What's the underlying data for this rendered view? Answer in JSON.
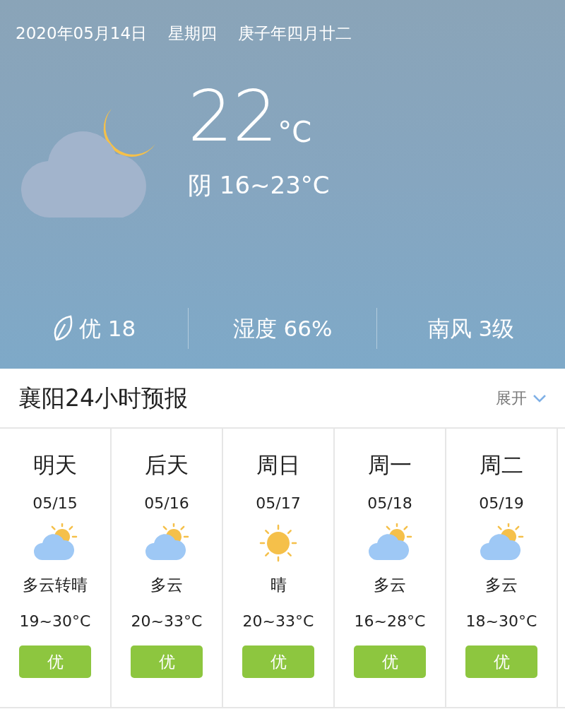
{
  "header": {
    "date": "2020年05月14日",
    "weekday": "星期四",
    "lunar": "庚子年四月廿二"
  },
  "current": {
    "temp": "22",
    "unit": "°C",
    "summary": "阴 16~23°C"
  },
  "stats": [
    {
      "kind": "aqi",
      "text": "优 18"
    },
    {
      "kind": "plain",
      "text": "湿度 66%"
    },
    {
      "kind": "plain",
      "text": "南风 3级"
    }
  ],
  "forecast": {
    "title": "襄阳24小时预报",
    "expand": "展开",
    "days": [
      {
        "day": "明天",
        "date": "05/15",
        "kind": "partly_cloudy",
        "weather": "多云转晴",
        "temp": "19~30°C",
        "aqi": "优"
      },
      {
        "day": "后天",
        "date": "05/16",
        "kind": "partly_cloudy",
        "weather": "多云",
        "temp": "20~33°C",
        "aqi": "优"
      },
      {
        "day": "周日",
        "date": "05/17",
        "kind": "sunny",
        "weather": "晴",
        "temp": "20~33°C",
        "aqi": "优"
      },
      {
        "day": "周一",
        "date": "05/18",
        "kind": "partly_cloudy",
        "weather": "多云",
        "temp": "16~28°C",
        "aqi": "优"
      },
      {
        "day": "周二",
        "date": "05/19",
        "kind": "partly_cloudy",
        "weather": "多云",
        "temp": "18~30°C",
        "aqi": "优"
      }
    ]
  }
}
